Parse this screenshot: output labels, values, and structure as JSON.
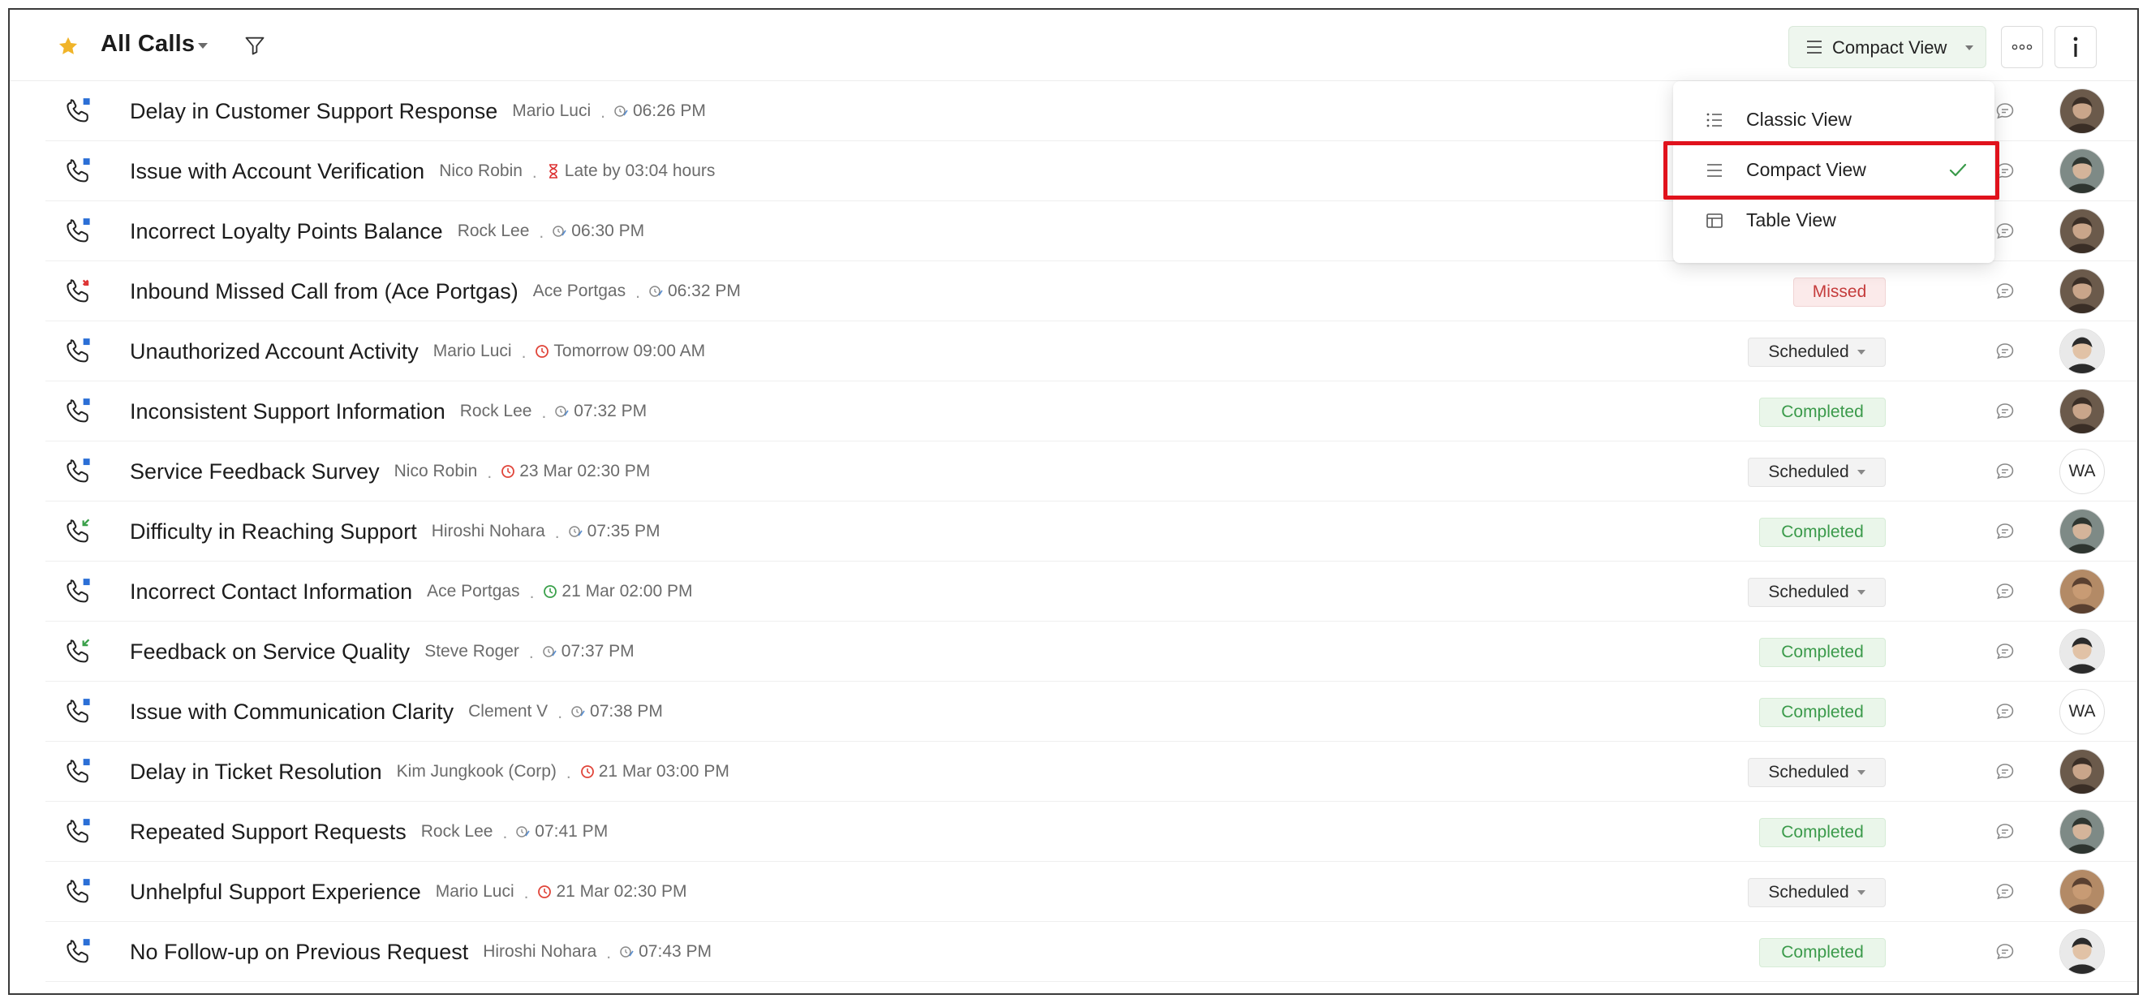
{
  "header": {
    "title": "All Calls",
    "view_button_label": "Compact View"
  },
  "dropdown": {
    "items": [
      {
        "label": "Classic View",
        "icon": "list-icon",
        "selected": false
      },
      {
        "label": "Compact View",
        "icon": "compact-lines-icon",
        "selected": true
      },
      {
        "label": "Table View",
        "icon": "table-icon",
        "selected": false
      }
    ]
  },
  "rows": [
    {
      "subject": "Delay in Customer Support Response",
      "contact": "Mario Luci",
      "meta_icon": "duration-icon",
      "meta": "06:26 PM",
      "status": "",
      "direction": "outgoing",
      "avatar": "photo-a",
      "initials": ""
    },
    {
      "subject": "Issue with Account Verification",
      "contact": "Nico Robin",
      "meta_icon": "hourglass-icon",
      "meta": "Late by 03:04 hours",
      "status": "",
      "direction": "outgoing",
      "avatar": "photo-b",
      "initials": ""
    },
    {
      "subject": "Incorrect Loyalty Points Balance",
      "contact": "Rock Lee",
      "meta_icon": "duration-icon",
      "meta": "06:30 PM",
      "status": "",
      "direction": "outgoing",
      "avatar": "photo-a",
      "initials": ""
    },
    {
      "subject": "Inbound Missed Call from (Ace Portgas)",
      "contact": "Ace Portgas",
      "meta_icon": "duration-icon",
      "meta": "06:32 PM",
      "status": "Missed",
      "direction": "missed",
      "avatar": "photo-a",
      "initials": ""
    },
    {
      "subject": "Unauthorized Account Activity",
      "contact": "Mario Luci",
      "meta_icon": "clock-red-icon",
      "meta": "Tomorrow 09:00 AM",
      "status": "Scheduled",
      "direction": "outgoing",
      "avatar": "photo-c",
      "initials": ""
    },
    {
      "subject": "Inconsistent Support Information",
      "contact": "Rock Lee",
      "meta_icon": "duration-icon",
      "meta": "07:32 PM",
      "status": "Completed",
      "direction": "outgoing",
      "avatar": "photo-a",
      "initials": ""
    },
    {
      "subject": "Service Feedback Survey",
      "contact": "Nico Robin",
      "meta_icon": "clock-red-icon",
      "meta": "23 Mar 02:30 PM",
      "status": "Scheduled",
      "direction": "outgoing",
      "avatar": "initials",
      "initials": "WA"
    },
    {
      "subject": "Difficulty in Reaching Support",
      "contact": "Hiroshi Nohara",
      "meta_icon": "duration-icon",
      "meta": "07:35 PM",
      "status": "Completed",
      "direction": "incoming",
      "avatar": "photo-b",
      "initials": ""
    },
    {
      "subject": "Incorrect Contact Information",
      "contact": "Ace Portgas",
      "meta_icon": "clock-green-icon",
      "meta": "21 Mar 02:00 PM",
      "status": "Scheduled",
      "direction": "outgoing",
      "avatar": "photo-d",
      "initials": ""
    },
    {
      "subject": "Feedback on Service Quality",
      "contact": "Steve Roger",
      "meta_icon": "duration-icon",
      "meta": "07:37 PM",
      "status": "Completed",
      "direction": "incoming",
      "avatar": "photo-c",
      "initials": ""
    },
    {
      "subject": "Issue with Communication Clarity",
      "contact": "Clement V",
      "meta_icon": "duration-icon",
      "meta": "07:38 PM",
      "status": "Completed",
      "direction": "outgoing",
      "avatar": "initials",
      "initials": "WA"
    },
    {
      "subject": "Delay in Ticket Resolution",
      "contact": "Kim Jungkook (Corp)",
      "meta_icon": "clock-red-icon",
      "meta": "21 Mar 03:00 PM",
      "status": "Scheduled",
      "direction": "outgoing",
      "avatar": "photo-a",
      "initials": ""
    },
    {
      "subject": "Repeated Support Requests",
      "contact": "Rock Lee",
      "meta_icon": "duration-icon",
      "meta": "07:41 PM",
      "status": "Completed",
      "direction": "outgoing",
      "avatar": "photo-b",
      "initials": ""
    },
    {
      "subject": "Unhelpful Support Experience",
      "contact": "Mario Luci",
      "meta_icon": "clock-red-icon",
      "meta": "21 Mar 02:30 PM",
      "status": "Scheduled",
      "direction": "outgoing",
      "avatar": "photo-d",
      "initials": ""
    },
    {
      "subject": "No Follow-up on Previous Request",
      "contact": "Hiroshi Nohara",
      "meta_icon": "duration-icon",
      "meta": "07:43 PM",
      "status": "Completed",
      "direction": "outgoing",
      "avatar": "photo-c",
      "initials": ""
    }
  ],
  "colors": {
    "accent_green": "#3a9a4a",
    "missed_red": "#c53c3c",
    "star_yellow": "#f0b429",
    "highlight_red": "#e0121c",
    "outgoing_blue": "#2b6fd6"
  }
}
